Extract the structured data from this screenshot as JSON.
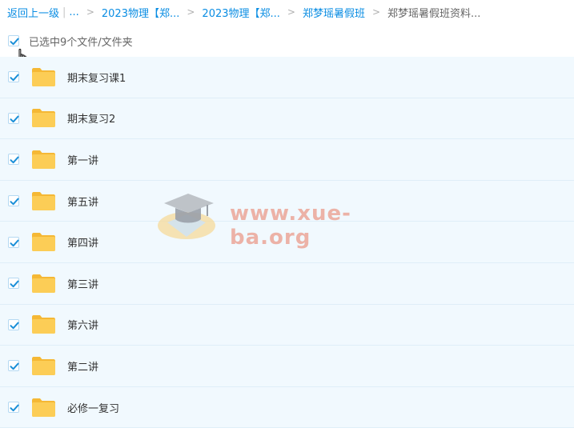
{
  "breadcrumb": {
    "back_label": "返回上一级",
    "separator_bar": "|",
    "ellipsis": "...",
    "items": [
      {
        "label": "2023物理【郑..."
      },
      {
        "label": "2023物理【郑..."
      },
      {
        "label": "郑梦瑶暑假班"
      }
    ],
    "current": "郑梦瑶暑假班资料...",
    "sep": ">"
  },
  "selection": {
    "label": "已选中9个文件/文件夹",
    "checked": true
  },
  "files": [
    {
      "name": "期末复习课1",
      "checked": true
    },
    {
      "name": "期末复习2",
      "checked": true
    },
    {
      "name": "第一讲",
      "checked": true
    },
    {
      "name": "第五讲",
      "checked": true
    },
    {
      "name": "第四讲",
      "checked": true
    },
    {
      "name": "第三讲",
      "checked": true
    },
    {
      "name": "第六讲",
      "checked": true
    },
    {
      "name": "第二讲",
      "checked": true
    },
    {
      "name": "必修一复习",
      "checked": true
    }
  ],
  "watermark": {
    "text": "www.xue-ba.org"
  },
  "colors": {
    "accent": "#0a8de3",
    "row_bg": "#f1f9fe",
    "folder": "#f9c74f",
    "check": "#1a8fd8"
  }
}
